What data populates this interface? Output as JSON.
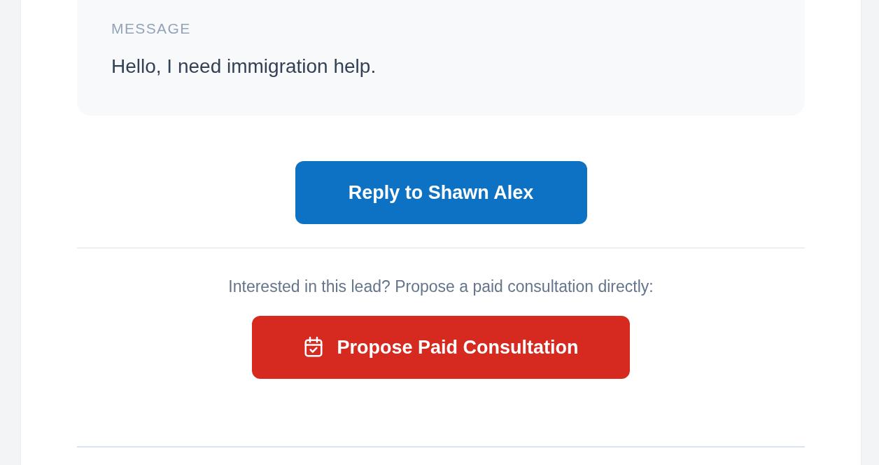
{
  "message": {
    "label": "MESSAGE",
    "text": "Hello, I need immigration help."
  },
  "reply_button": {
    "label": "Reply to Shawn Alex"
  },
  "consultation": {
    "prompt": "Interested in this lead? Propose a paid consultation directly:",
    "button": {
      "label": "Propose Paid Consultation"
    }
  }
}
